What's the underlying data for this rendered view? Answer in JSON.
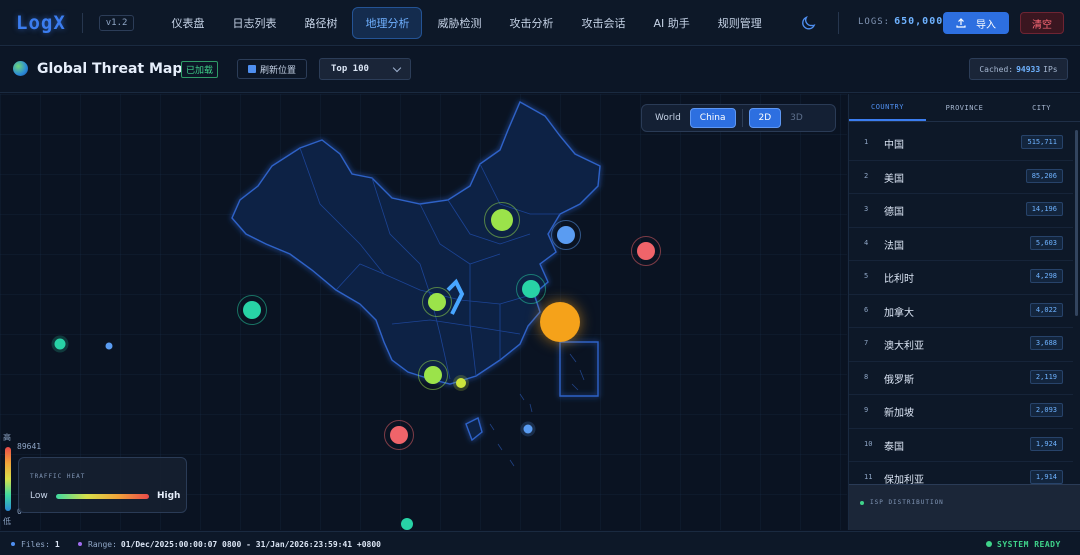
{
  "app": {
    "logo": "LogX",
    "version": "v1.2"
  },
  "nav": {
    "items": [
      {
        "label": "仪表盘"
      },
      {
        "label": "日志列表"
      },
      {
        "label": "路径树"
      },
      {
        "label": "地理分析",
        "active": true
      },
      {
        "label": "威胁检测"
      },
      {
        "label": "攻击分析"
      },
      {
        "label": "攻击会话"
      },
      {
        "label": "AI 助手"
      },
      {
        "label": "规则管理"
      }
    ]
  },
  "header": {
    "logs_label": "LOGS:",
    "logs_count": "650,000",
    "import_label": "导入",
    "clear_label": "清空"
  },
  "toolbar": {
    "title": "Global Threat Map",
    "loaded_badge": "已加载",
    "refresh_label": "刷新位置",
    "top_select_value": "Top 100",
    "cached_label": "Cached:",
    "cached_count": "94933",
    "cached_unit": "IPs"
  },
  "map": {
    "view_world": "World",
    "view_china": "China",
    "mode_2d": "2D",
    "mode_3d": "3D",
    "active_view": "China",
    "active_mode": "2D"
  },
  "legend": {
    "high_label": "高",
    "low_label": "低",
    "max_value": "89641",
    "min_value": "0",
    "heat_title": "TRAFFIC HEAT",
    "heat_low": "Low",
    "heat_high": "High"
  },
  "panel": {
    "tabs": [
      "COUNTRY",
      "PROVINCE",
      "CITY"
    ],
    "active_tab": "COUNTRY",
    "countries": [
      {
        "rank": "1",
        "name": "中国",
        "count": "515,711"
      },
      {
        "rank": "2",
        "name": "美国",
        "count": "85,206"
      },
      {
        "rank": "3",
        "name": "德国",
        "count": "14,196"
      },
      {
        "rank": "4",
        "name": "法国",
        "count": "5,603"
      },
      {
        "rank": "5",
        "name": "比利时",
        "count": "4,298"
      },
      {
        "rank": "6",
        "name": "加拿大",
        "count": "4,022"
      },
      {
        "rank": "7",
        "name": "澳大利亚",
        "count": "3,688"
      },
      {
        "rank": "8",
        "name": "俄罗斯",
        "count": "2,119"
      },
      {
        "rank": "9",
        "name": "新加坡",
        "count": "2,093"
      },
      {
        "rank": "10",
        "name": "泰国",
        "count": "1,924"
      },
      {
        "rank": "11",
        "name": "保加利亚",
        "count": "1,914"
      }
    ],
    "isp_label": "ISP DISTRIBUTION"
  },
  "status": {
    "files_label": "Files:",
    "files_count": "1",
    "range_label": "Range:",
    "range_value": "01/Dec/2025:00:00:07 0800 - 31/Jan/2026:23:59:41 +0800",
    "ready_label": "SYSTEM READY"
  },
  "colors": {
    "accent": "#3b7df0",
    "danger": "#ff6a78",
    "ok": "#3fd38a",
    "hotspot_red": "#f0646a",
    "hotspot_orange": "#f5a21a",
    "hotspot_green": "#9be34a",
    "hotspot_teal": "#28d3a6",
    "hotspot_blue": "#5a9cf2"
  },
  "icons": {
    "theme": "moon-icon",
    "import": "upload-icon",
    "globe": "globe-icon",
    "refresh": "location-refresh-icon",
    "dropdown": "chevron-down-icon"
  }
}
